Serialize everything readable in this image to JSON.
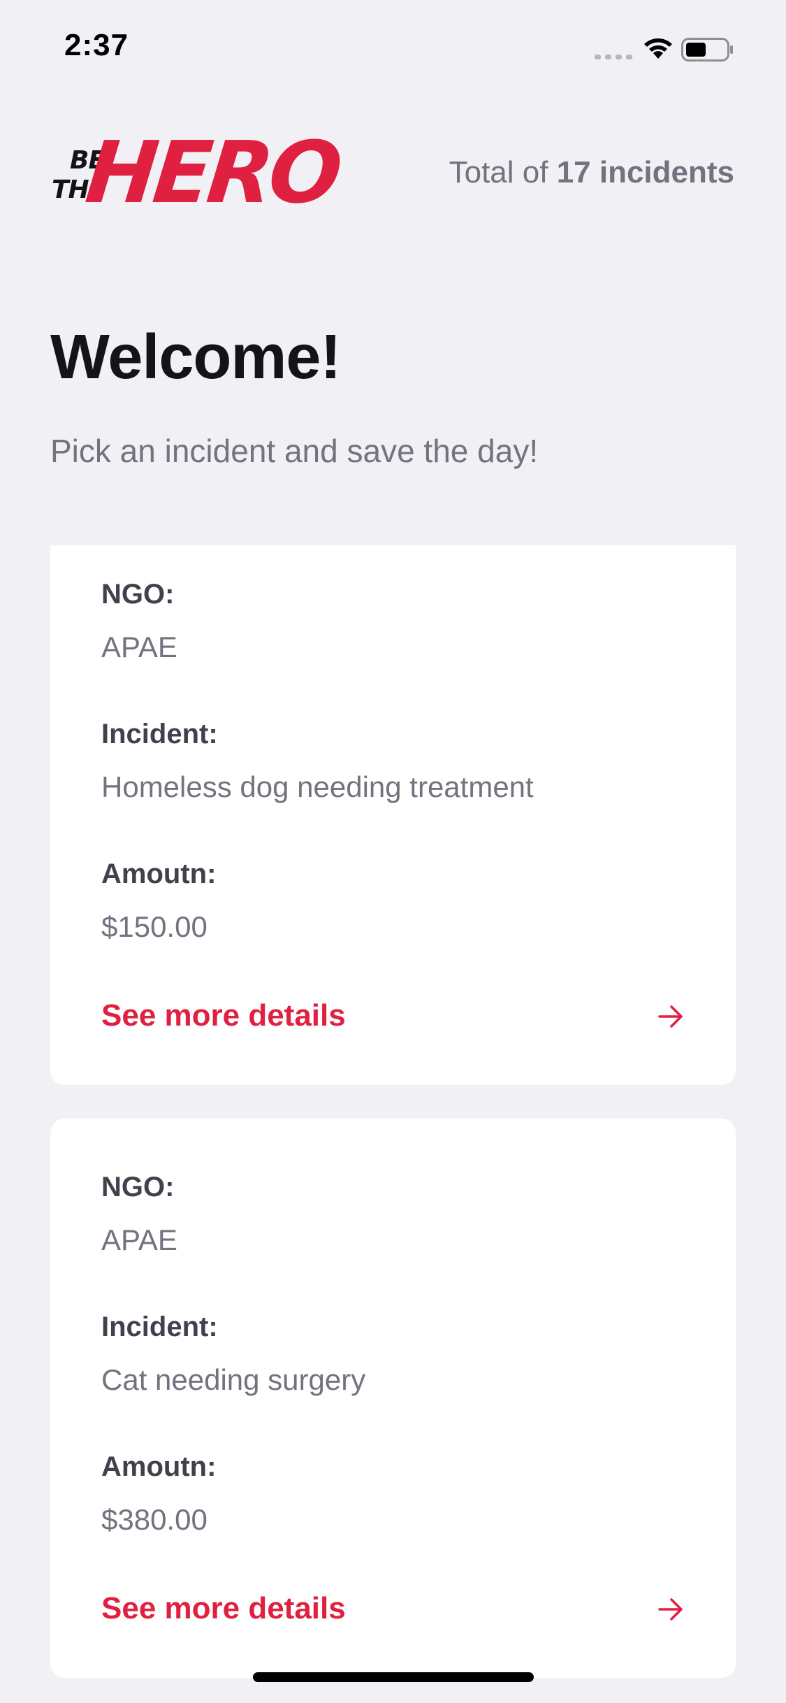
{
  "status_bar": {
    "time": "2:37"
  },
  "header": {
    "logo": {
      "be": "BE",
      "the": "THE",
      "hero": "HERO"
    },
    "total_prefix": "Total of ",
    "total_count": "17 incidents"
  },
  "main": {
    "title": "Welcome!",
    "subtitle": "Pick an incident and save the day!"
  },
  "incidents": [
    {
      "ngo_label": "NGO:",
      "ngo": "APAE",
      "incident_label": "Incident:",
      "incident": "Homeless dog needing treatment",
      "amount_label": "Amoutn:",
      "amount": "$150.00",
      "details_label": "See more details"
    },
    {
      "ngo_label": "NGO:",
      "ngo": "APAE",
      "incident_label": "Incident:",
      "incident": "Cat needing surgery",
      "amount_label": "Amoutn:",
      "amount": "$380.00",
      "details_label": "See more details"
    }
  ],
  "colors": {
    "background": "#f0f0f5",
    "brand": "#e02041",
    "title": "#13131a",
    "label": "#41414d",
    "muted": "#737380",
    "card": "#ffffff"
  },
  "icons": {
    "signal": "cellular-signal-icon",
    "wifi": "wifi-icon",
    "battery": "battery-icon",
    "arrow": "arrow-right-icon"
  }
}
